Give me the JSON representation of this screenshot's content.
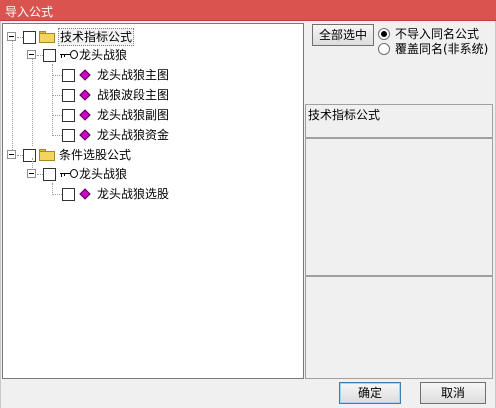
{
  "window": {
    "title": "导入公式"
  },
  "tree": {
    "root1": {
      "label": "技术指标公式",
      "child": {
        "label": "龙头战狼",
        "items": [
          "龙头战狼主图",
          "战狼波段主图",
          "龙头战狼副图",
          "龙头战狼资金"
        ]
      }
    },
    "root2": {
      "label": "条件选股公式",
      "child": {
        "label": "龙头战狼",
        "items": [
          "龙头战狼选股"
        ]
      }
    }
  },
  "right": {
    "select_all_label": "全部选中",
    "radio_options": [
      "不导入同名公式",
      "覆盖同名(非系统)"
    ],
    "radio_selected": 0,
    "info_title": "技术指标公式"
  },
  "footer": {
    "ok_label": "确定",
    "cancel_label": "取消"
  }
}
